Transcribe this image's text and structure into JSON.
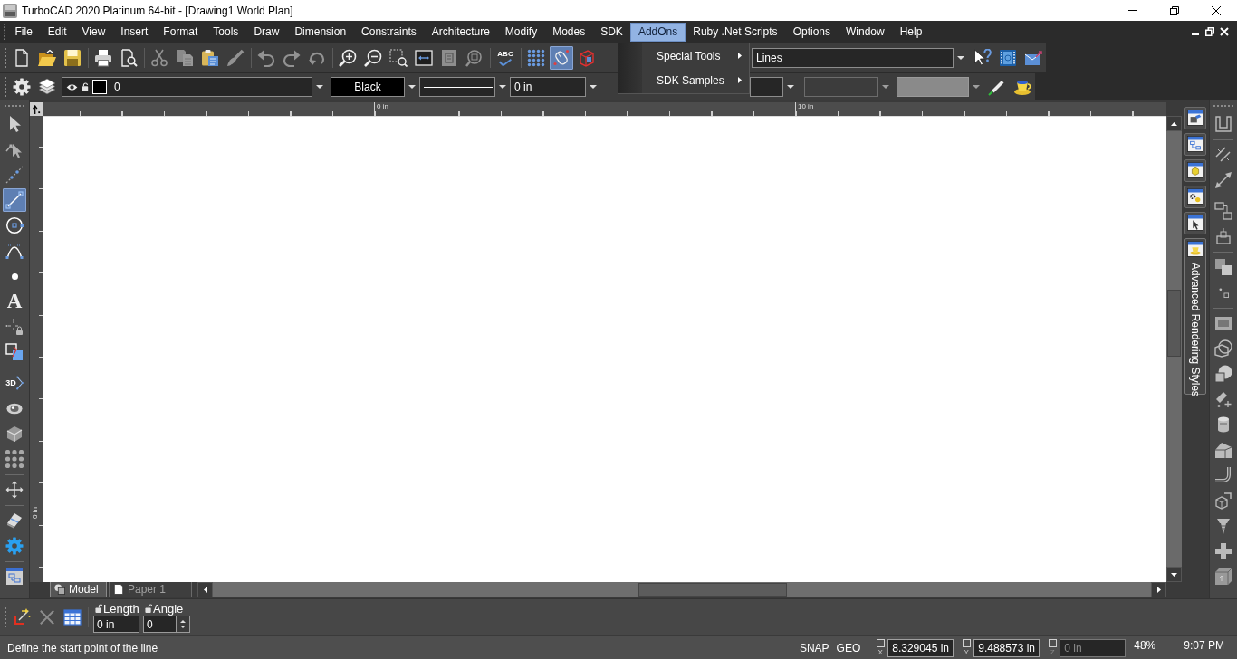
{
  "window": {
    "title": "TurboCAD 2020 Platinum 64-bit - [Drawing1 World Plan]"
  },
  "menu_bar": {
    "items": [
      {
        "label": "File",
        "selected": false
      },
      {
        "label": "Edit",
        "selected": false
      },
      {
        "label": "View",
        "selected": false
      },
      {
        "label": "Insert",
        "selected": false
      },
      {
        "label": "Format",
        "selected": false
      },
      {
        "label": "Tools",
        "selected": false
      },
      {
        "label": "Draw",
        "selected": false
      },
      {
        "label": "Dimension",
        "selected": false
      },
      {
        "label": "Constraints",
        "selected": false
      },
      {
        "label": "Architecture",
        "selected": false
      },
      {
        "label": "Modify",
        "selected": false
      },
      {
        "label": "Modes",
        "selected": false
      },
      {
        "label": "SDK",
        "selected": false
      },
      {
        "label": "AddOns",
        "selected": true
      },
      {
        "label": "Ruby .Net Scripts",
        "selected": false
      },
      {
        "label": "Options",
        "selected": false
      },
      {
        "label": "Window",
        "selected": false
      },
      {
        "label": "Help",
        "selected": false
      }
    ]
  },
  "open_menu": {
    "items": [
      {
        "label": "Special Tools",
        "submenu": true
      },
      {
        "label": "SDK Samples",
        "submenu": true
      }
    ]
  },
  "standard_toolbar": {
    "groups": [
      {
        "tools": [
          {
            "kind": "new",
            "selected": false,
            "disabled": false
          },
          {
            "kind": "open",
            "selected": false,
            "disabled": false
          },
          {
            "kind": "save",
            "selected": false,
            "disabled": false
          }
        ]
      },
      {
        "tools": [
          {
            "kind": "print",
            "selected": false,
            "disabled": false
          },
          {
            "kind": "preview",
            "selected": false,
            "disabled": false
          }
        ]
      },
      {
        "tools": [
          {
            "kind": "cut",
            "selected": false,
            "disabled": true
          },
          {
            "kind": "copy",
            "selected": false,
            "disabled": true
          },
          {
            "kind": "paste",
            "selected": false,
            "disabled": false
          },
          {
            "kind": "painter",
            "selected": false,
            "disabled": true
          }
        ]
      },
      {
        "tools": [
          {
            "kind": "undo",
            "selected": false,
            "disabled": true
          },
          {
            "kind": "redo",
            "selected": false,
            "disabled": true
          },
          {
            "kind": "repeat",
            "selected": false,
            "disabled": true
          }
        ]
      },
      {
        "tools": [
          {
            "kind": "zoom_in",
            "selected": false,
            "disabled": false
          },
          {
            "kind": "zoom_out",
            "selected": false,
            "disabled": false
          },
          {
            "kind": "zoom_window",
            "selected": false,
            "disabled": false
          },
          {
            "kind": "zoom_extents",
            "selected": false,
            "disabled": false
          },
          {
            "kind": "zoom_page",
            "selected": false,
            "disabled": true
          },
          {
            "kind": "zoom_selection",
            "selected": false,
            "disabled": true
          }
        ]
      },
      {
        "tools": [
          {
            "kind": "spell",
            "glyph": "ABC",
            "selected": false,
            "disabled": false
          }
        ]
      },
      {
        "tools": [
          {
            "kind": "dot_grid",
            "selected": false,
            "disabled": false
          },
          {
            "kind": "mouse",
            "selected": true,
            "disabled": false
          },
          {
            "kind": "cube_outline",
            "selected": false,
            "disabled": false
          }
        ]
      }
    ],
    "style_dropdown": {
      "value": "Lines"
    },
    "end_tools": [
      {
        "kind": "help",
        "selected": false
      },
      {
        "kind": "film",
        "selected": false
      },
      {
        "kind": "mail",
        "selected": false
      }
    ]
  },
  "property_toolbar": {
    "tools": [
      {
        "kind": "settings",
        "selected": false
      },
      {
        "kind": "layers",
        "selected": false
      }
    ],
    "layer": {
      "value": "0"
    },
    "pen_color": {
      "value": "Black"
    },
    "line_width": {
      "value": "0 in"
    },
    "end_tools": [
      {
        "kind": "pencil",
        "selected": false
      },
      {
        "kind": "teacup",
        "selected": false
      }
    ]
  },
  "left_toolbar": {
    "groups": [
      {
        "tools": [
          {
            "kind": "select",
            "selected": false
          },
          {
            "kind": "node_select",
            "selected": false
          },
          {
            "kind": "construct",
            "selected": false
          },
          {
            "kind": "line",
            "selected": true
          },
          {
            "kind": "circle",
            "selected": false
          },
          {
            "kind": "arc",
            "selected": false
          },
          {
            "kind": "point",
            "selected": false
          },
          {
            "kind": "text",
            "glyph": "A",
            "selected": false
          },
          {
            "kind": "dim_lock",
            "selected": false
          },
          {
            "kind": "modify",
            "selected": false
          }
        ]
      },
      {
        "tools": [
          {
            "kind": "three_d",
            "glyph": "3D",
            "selected": false
          },
          {
            "kind": "eyeball",
            "selected": false
          },
          {
            "kind": "box",
            "selected": false
          },
          {
            "kind": "circle_grid",
            "selected": false
          }
        ]
      },
      {
        "tools": [
          {
            "kind": "move",
            "selected": false
          }
        ]
      },
      {
        "tools": [
          {
            "kind": "eraser",
            "selected": false
          },
          {
            "kind": "gear",
            "selected": false
          }
        ]
      },
      {
        "tools": [
          {
            "kind": "layout",
            "selected": false
          }
        ]
      }
    ]
  },
  "horizontal_ruler": {
    "labels": [
      "0 in",
      "10 in"
    ]
  },
  "vertical_ruler": {
    "labels": [
      "0 in"
    ]
  },
  "sheet_tabs": [
    {
      "kind": "model",
      "label": "Model",
      "selected": true
    },
    {
      "kind": "paper",
      "label": "Paper 1",
      "selected": false
    }
  ],
  "panel_tabs": [
    {
      "kind": "win_tools",
      "selected": false
    },
    {
      "kind": "win_diagram",
      "selected": false
    },
    {
      "kind": "win_cube",
      "selected": false
    },
    {
      "kind": "win_gears",
      "selected": false
    },
    {
      "kind": "win_pointer",
      "selected": false
    },
    {
      "kind": "win_teacup",
      "selected": true,
      "label": "Advanced Rendering Styles"
    }
  ],
  "right_toolbar": {
    "groups": [
      {
        "tools": [
          {
            "kind": "u_channel",
            "selected": false
          }
        ]
      },
      {
        "tools": [
          {
            "kind": "parallel",
            "selected": false
          },
          {
            "kind": "double_arrow",
            "selected": false
          }
        ]
      },
      {
        "tools": [
          {
            "kind": "linked",
            "selected": false
          },
          {
            "kind": "box_outline",
            "selected": false
          }
        ]
      },
      {
        "tools": [
          {
            "kind": "stacked",
            "selected": false
          },
          {
            "kind": "dot_square",
            "selected": false
          }
        ]
      },
      {
        "tools": [
          {
            "kind": "panel",
            "selected": false
          },
          {
            "kind": "overlap",
            "selected": false
          },
          {
            "kind": "sphere_box",
            "selected": false
          },
          {
            "kind": "sparkle",
            "selected": false
          },
          {
            "kind": "cylinder",
            "selected": false
          },
          {
            "kind": "wedge",
            "selected": false
          },
          {
            "kind": "pipe",
            "selected": false
          },
          {
            "kind": "cube_arrow",
            "selected": false
          },
          {
            "kind": "screw",
            "selected": false
          },
          {
            "kind": "plus",
            "selected": false
          },
          {
            "kind": "cube",
            "selected": false
          }
        ]
      }
    ]
  },
  "inspector": {
    "tools": [
      {
        "kind": "wizard",
        "disabled": false
      },
      {
        "kind": "cancel",
        "disabled": true
      },
      {
        "kind": "table",
        "disabled": false
      }
    ],
    "fields": [
      {
        "kind": "text",
        "label": "Length",
        "locked": false,
        "value": "0 in"
      },
      {
        "kind": "spin",
        "label": "Angle",
        "locked": false,
        "value": "0"
      }
    ]
  },
  "status_bar": {
    "prompt": "Define the start point of the line",
    "modes": [
      "SNAP",
      "GEO"
    ],
    "coordinates": [
      {
        "axis": "X",
        "checked": false,
        "disabled": false,
        "value": "8.329045 in"
      },
      {
        "axis": "Y",
        "checked": false,
        "disabled": false,
        "value": "9.488573 in"
      },
      {
        "axis": "Z",
        "checked": false,
        "disabled": true,
        "value": "0 in"
      }
    ],
    "zoom": "48%",
    "time": "9:07 PM"
  }
}
